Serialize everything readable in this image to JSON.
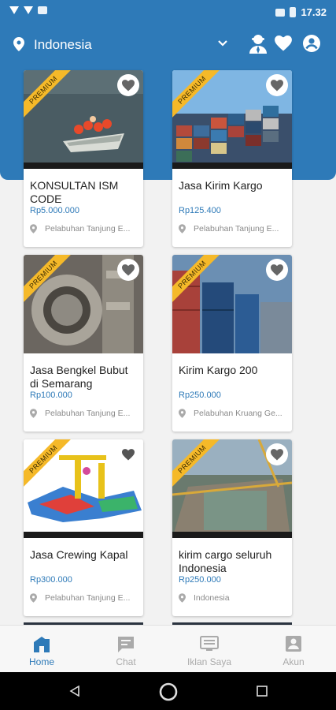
{
  "statusbar": {
    "time": "17.32"
  },
  "header": {
    "location": "Indonesia"
  },
  "products": [
    {
      "title": "KONSULTAN ISM CODE",
      "price": "Rp5.000.000",
      "location": "Pelabuhan Tanjung E...",
      "badge": "PREMIUM"
    },
    {
      "title": "Jasa Kirim Kargo",
      "price": "Rp125.400",
      "location": "Pelabuhan Tanjung E...",
      "badge": "PREMIUM"
    },
    {
      "title": "Jasa Bengkel Bubut di Semarang",
      "price": "Rp100.000",
      "location": "Pelabuhan Tanjung E...",
      "badge": "PREMIUM"
    },
    {
      "title": "Kirim Kargo 200",
      "price": "Rp250.000",
      "location": "Pelabuhan Kruang Ge...",
      "badge": "PREMIUM"
    },
    {
      "title": "Jasa Crewing Kapal",
      "price": "Rp300.000",
      "location": "Pelabuhan Tanjung E...",
      "badge": "PREMIUM"
    },
    {
      "title": "kirim cargo seluruh Indonesia",
      "price": "Rp250.000",
      "location": "Indonesia",
      "badge": "PREMIUM"
    }
  ],
  "bottom_nav": [
    {
      "label": "Home",
      "icon": "home-icon",
      "active": true
    },
    {
      "label": "Chat",
      "icon": "chat-icon"
    },
    {
      "label": "Iklan Saya",
      "icon": "ads-icon"
    },
    {
      "label": "Akun",
      "icon": "account-icon"
    }
  ],
  "colors": {
    "primary": "#2e7ab8",
    "ribbon": "#f5b929"
  }
}
